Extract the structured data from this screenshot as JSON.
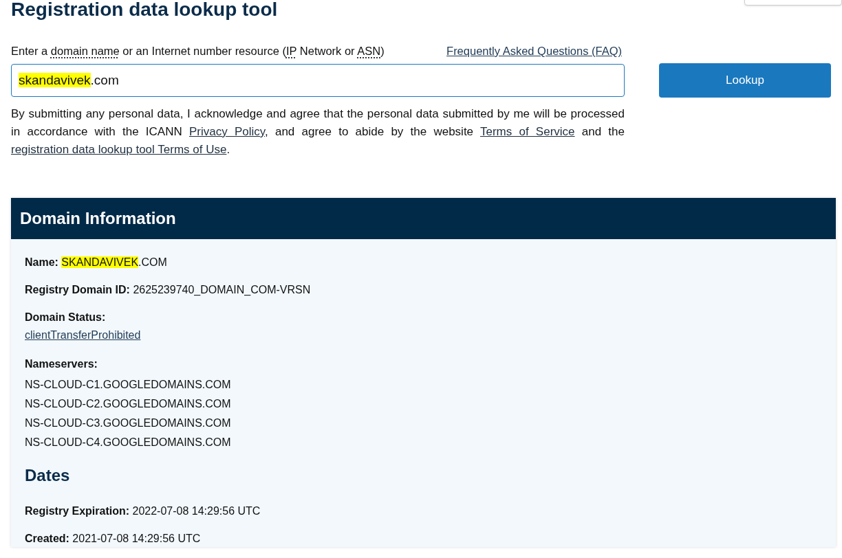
{
  "title": "Registration data lookup tool",
  "instruction": [
    {
      "text": "Enter a ",
      "kind": "plain"
    },
    {
      "text": "domain name",
      "kind": "abbr"
    },
    {
      "text": " or an Internet number resource (",
      "kind": "plain"
    },
    {
      "text": "IP",
      "kind": "abbr"
    },
    {
      "text": " Network or ",
      "kind": "plain"
    },
    {
      "text": "ASN",
      "kind": "abbr"
    },
    {
      "text": ")",
      "kind": "plain"
    }
  ],
  "faq_link": "Frequently Asked Questions (FAQ)",
  "search": {
    "value_parts": [
      {
        "text": "skandavivek",
        "highlighted": true
      },
      {
        "text": ".com",
        "highlighted": false
      }
    ]
  },
  "lookup_button": "Lookup",
  "disclaimer": [
    {
      "text": "By submitting any personal data, I acknowledge and agree that the personal data submitted by me will be processed in accordance with the ICANN ",
      "kind": "plain"
    },
    {
      "text": "Privacy Policy",
      "kind": "link"
    },
    {
      "text": ", and agree to abide by the website ",
      "kind": "plain"
    },
    {
      "text": "Terms of Service",
      "kind": "link"
    },
    {
      "text": " and the ",
      "kind": "plain"
    },
    {
      "text": "registration data lookup tool Terms of Use",
      "kind": "link"
    },
    {
      "text": ".",
      "kind": "plain"
    }
  ],
  "domain_information": {
    "heading": "Domain Information",
    "sections": [
      {
        "fields": [
          {
            "kind": "inline",
            "label": "Name:",
            "value_parts": [
              {
                "text": "SKANDAVIVEK",
                "highlighted": true
              },
              {
                "text": ".COM",
                "highlighted": false
              }
            ]
          },
          {
            "kind": "inline",
            "label": "Registry Domain ID:",
            "value_parts": [
              {
                "text": "2625239740_DOMAIN_COM-VRSN",
                "highlighted": false
              }
            ]
          },
          {
            "kind": "links",
            "label": "Domain Status:",
            "items": [
              "clientTransferProhibited"
            ]
          },
          {
            "kind": "lines",
            "label": "Nameservers:",
            "items": [
              "NS-CLOUD-C1.GOOGLEDOMAINS.COM",
              "NS-CLOUD-C2.GOOGLEDOMAINS.COM",
              "NS-CLOUD-C3.GOOGLEDOMAINS.COM",
              "NS-CLOUD-C4.GOOGLEDOMAINS.COM"
            ]
          }
        ]
      },
      {
        "heading": "Dates",
        "fields": [
          {
            "kind": "inline",
            "label": "Registry Expiration:",
            "value_parts": [
              {
                "text": "2022-07-08 14:29:56 UTC",
                "highlighted": false
              }
            ]
          },
          {
            "kind": "inline",
            "label": "Created:",
            "value_parts": [
              {
                "text": "2021-07-08 14:29:56 UTC",
                "highlighted": false
              }
            ]
          }
        ]
      }
    ]
  }
}
